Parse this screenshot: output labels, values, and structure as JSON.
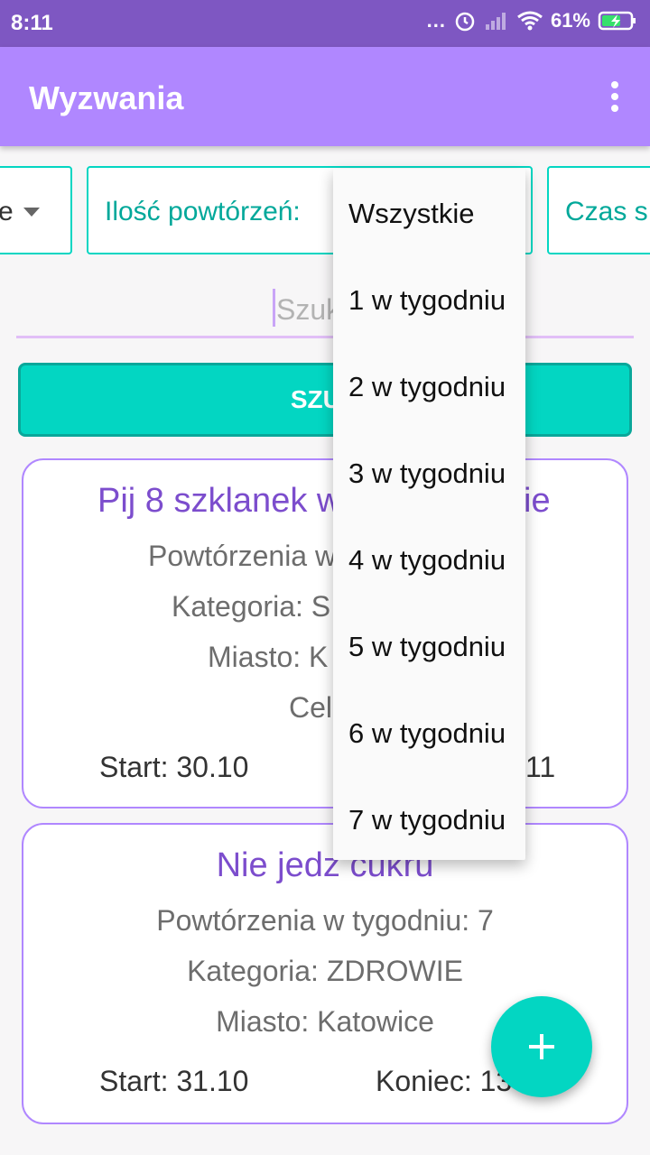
{
  "status": {
    "time": "8:11",
    "dots": "...",
    "battery": "61%"
  },
  "appbar": {
    "title": "Wyzwania"
  },
  "filters": {
    "first": "e",
    "repetitions": "Ilość powtórzeń:",
    "time": "Czas s"
  },
  "search": {
    "placeholder": "Szuk",
    "button": "SZUK"
  },
  "cards": [
    {
      "title": "Pij 8 szklanek w",
      "title_end": "ie",
      "repetitions": "Powtórzenia w",
      "category": "Kategoria: S",
      "city": "Miasto: K",
      "goal": "Cel:",
      "start": "Start: 30.10",
      "end": "11"
    },
    {
      "title": "Nie jedz cukru",
      "repetitions": "Powtórzenia w tygodniu: 7",
      "category": "Kategoria: ZDROWIE",
      "city": "Miasto: Katowice",
      "start": "Start: 31.10",
      "end": "Koniec: 13"
    }
  ],
  "dropdown": {
    "options": [
      "Wszystkie",
      "1 w tygodniu",
      "2 w tygodniu",
      "3 w tygodniu",
      "4 w tygodniu",
      "5 w tygodniu",
      "6 w tygodniu",
      "7 w tygodniu"
    ]
  },
  "colors": {
    "status_bar": "#7e57c2",
    "app_bar": "#b087ff",
    "accent": "#03d6c2",
    "card_title": "#7c4dcd"
  },
  "icons": [
    "alarm-icon",
    "signal-icon",
    "wifi-icon",
    "battery-charging-icon",
    "overflow-menu-icon",
    "plus-icon",
    "dropdown-caret-icon"
  ]
}
